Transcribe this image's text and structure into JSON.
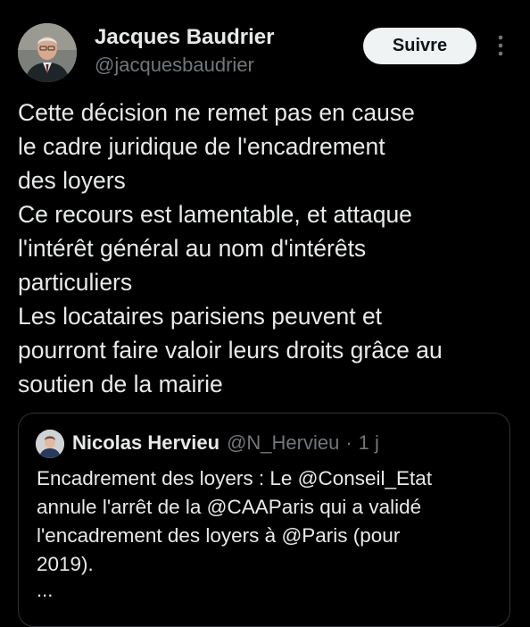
{
  "author": {
    "name": "Jacques Baudrier",
    "handle": "@jacquesbaudrier"
  },
  "follow_button": {
    "label": "Suivre"
  },
  "icons": {
    "avatar": "avatar-photo",
    "more": "more-vertical-icon"
  },
  "tweet": {
    "lines": [
      "Cette décision ne remet pas en cause",
      "le cadre juridique de l'encadrement",
      "des loyers",
      "Ce recours est lamentable, et attaque",
      "l'intérêt général au nom d'intérêts",
      "particuliers",
      "Les locataires parisiens peuvent et",
      "pourront faire valoir leurs droits grâce au",
      "soutien de la mairie"
    ]
  },
  "quoted_tweet": {
    "name": "Nicolas Hervieu",
    "handle": "@N_Hervieu",
    "separator": "·",
    "time": "1 j",
    "lines": [
      "Encadrement des loyers : Le @Conseil_Etat",
      "annule l'arrêt de la @CAAParis qui a validé",
      "l'encadrement des loyers à @Paris (pour",
      "2019)."
    ],
    "ellipsis": "..."
  },
  "colors": {
    "background": "#000000",
    "primary_text": "#e7e9ea",
    "secondary_text": "#71767b",
    "border": "#2f3336",
    "button_bg": "#eff3f4"
  }
}
